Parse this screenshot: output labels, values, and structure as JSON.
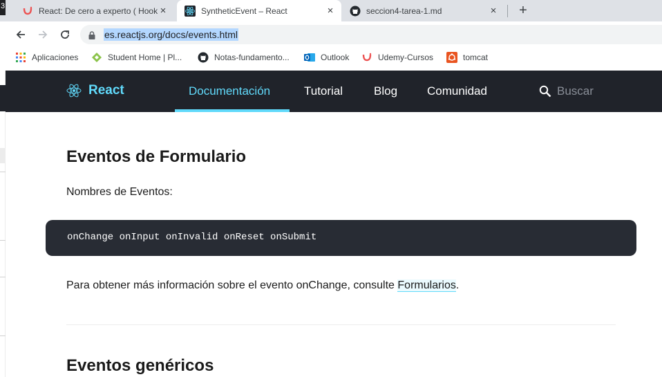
{
  "window": {
    "corner_label": "3"
  },
  "tabs": [
    {
      "title": "React: De cero a experto ( Hook",
      "icon": "udemy-icon"
    },
    {
      "title": "SyntheticEvent – React",
      "icon": "react-icon"
    },
    {
      "title": "seccion4-tarea-1.md",
      "icon": "github-icon"
    }
  ],
  "new_tab_label": "+",
  "close_label": "×",
  "address_bar": {
    "url": "es.reactjs.org/docs/events.html"
  },
  "bookmarks": [
    {
      "label": "Aplicaciones",
      "icon": "apps-grid-icon"
    },
    {
      "label": "Student Home | Pl...",
      "icon": "student-home-icon"
    },
    {
      "label": "Notas-fundamento...",
      "icon": "github-icon"
    },
    {
      "label": "Outlook",
      "icon": "outlook-icon"
    },
    {
      "label": "Udemy-Cursos",
      "icon": "udemy-icon"
    },
    {
      "label": "tomcat",
      "icon": "tomcat-icon"
    }
  ],
  "site_nav": {
    "brand": "React",
    "links": [
      "Documentación",
      "Tutorial",
      "Blog",
      "Comunidad"
    ],
    "active": "Documentación",
    "search_placeholder": "Buscar"
  },
  "content": {
    "heading_form": "Eventos de Formulario",
    "event_names_label": "Nombres de Eventos:",
    "code": "onChange onInput onInvalid onReset onSubmit",
    "info_before": "Para obtener más información sobre el evento onChange, consulte ",
    "info_link": "Formularios",
    "info_after": ".",
    "heading_generic": "Eventos genéricos"
  },
  "colors": {
    "react_blue": "#61dafb",
    "nav_bg": "#20232a",
    "code_bg": "#282c34"
  }
}
